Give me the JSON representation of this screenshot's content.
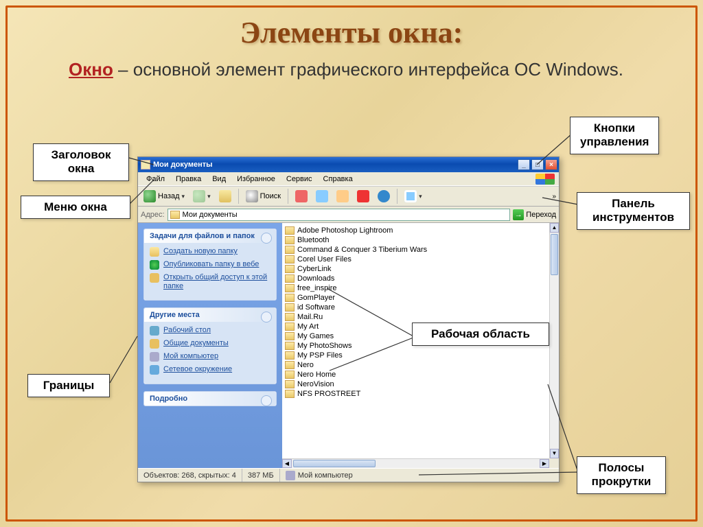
{
  "slide": {
    "title": "Элементы окна:",
    "definition_keyword": "Окно",
    "definition_text": " – основной элемент графического интерфейса ОС Windows."
  },
  "callouts": {
    "titlebar": "Заголовок окна",
    "menu": "Меню окна",
    "borders": "Границы",
    "controls": "Кнопки управления",
    "toolbar": "Панель инструментов",
    "workarea": "Рабочая область",
    "scrollbars": "Полосы прокрутки"
  },
  "window": {
    "title": "Мои документы",
    "menubar": [
      "Файл",
      "Правка",
      "Вид",
      "Избранное",
      "Сервис",
      "Справка"
    ],
    "toolbar": {
      "back": "Назад",
      "search": "Поиск"
    },
    "addressbar": {
      "label": "Адрес:",
      "value": "Мои документы",
      "go": "Переход"
    },
    "tasks_panel": {
      "header": "Задачи для файлов и папок",
      "items": [
        "Создать новую папку",
        "Опубликовать папку в вебе",
        "Открыть общий доступ к этой папке"
      ]
    },
    "places_panel": {
      "header": "Другие места",
      "items": [
        "Рабочий стол",
        "Общие документы",
        "Мой компьютер",
        "Сетевое окружение"
      ]
    },
    "details_panel": {
      "header": "Подробно"
    },
    "folders": [
      "Adobe Photoshop Lightroom",
      "Bluetooth",
      "Command & Conquer 3 Tiberium Wars",
      "Corel User Files",
      "CyberLink",
      "Downloads",
      "free_inspire",
      "GomPlayer",
      "id Software",
      "Mail.Ru",
      "My Art",
      "My Games",
      "My PhotoShows",
      "My PSP Files",
      "Nero",
      "Nero Home",
      "NeroVision",
      "NFS PROSTREET"
    ],
    "statusbar": {
      "objects": "Объектов: 268, скрытых: 4",
      "size": "387 МБ",
      "location": "Мой компьютер"
    }
  }
}
